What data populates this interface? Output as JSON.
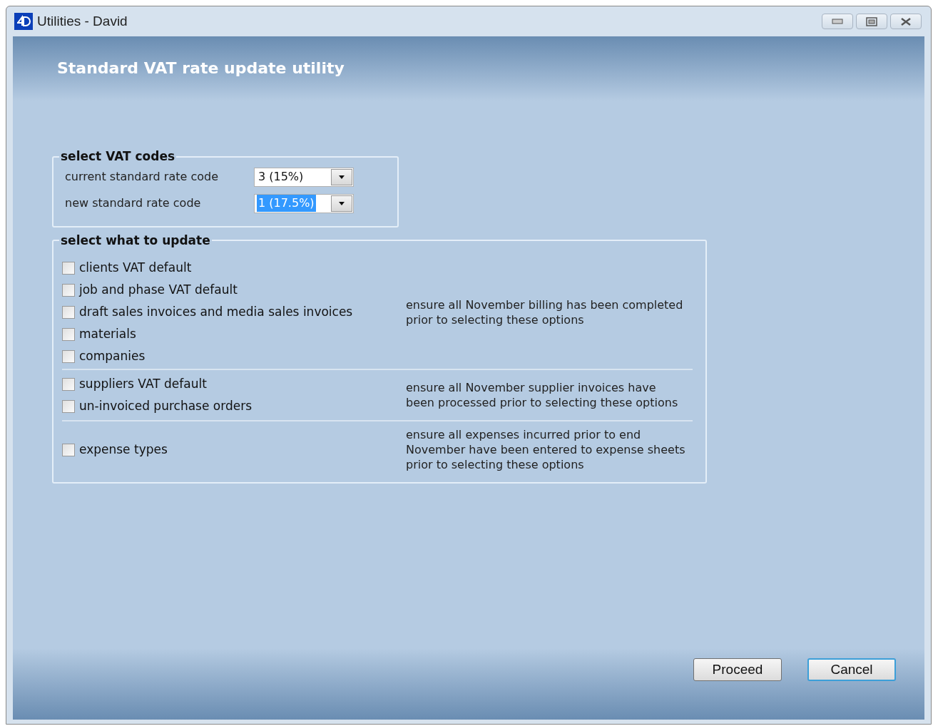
{
  "window": {
    "title": "Utilities - David"
  },
  "header": {
    "title": "Standard VAT rate update utility"
  },
  "vat_codes": {
    "legend": "select VAT codes",
    "fields": [
      {
        "label": "current standard rate code",
        "value": "3 (15%)",
        "highlighted": false
      },
      {
        "label": "new standard rate code",
        "value": "1 (17.5%)",
        "highlighted": true
      }
    ]
  },
  "update": {
    "legend": "select what to update",
    "sections": [
      {
        "items": [
          {
            "label": "clients VAT default",
            "checked": false
          },
          {
            "label": "job and phase VAT default",
            "checked": false
          },
          {
            "label": "draft sales invoices and media sales invoices",
            "checked": false
          },
          {
            "label": "materials",
            "checked": false
          },
          {
            "label": "companies",
            "checked": false
          }
        ],
        "note": "ensure all November billing has been completed prior to selecting these options"
      },
      {
        "items": [
          {
            "label": "suppliers VAT default",
            "checked": false
          },
          {
            "label": "un-invoiced purchase orders",
            "checked": false
          }
        ],
        "note": "ensure all November supplier invoices have been processed prior to selecting these options"
      },
      {
        "items": [
          {
            "label": "expense types",
            "checked": false
          }
        ],
        "note": "ensure all expenses incurred prior to end November have been entered to expense sheets prior to selecting these options"
      }
    ]
  },
  "buttons": [
    {
      "label": "Proceed",
      "focused": false
    },
    {
      "label": "Cancel",
      "focused": true
    }
  ]
}
